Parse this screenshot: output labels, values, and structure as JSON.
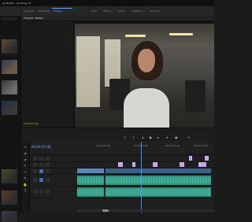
{
  "window": {
    "title": "Ae Master - p(change it)"
  },
  "workspaces": [
    {
      "label": "Learning",
      "active": false
    },
    {
      "label": "Assembly",
      "active": false
    },
    {
      "label": "Editing",
      "active": true
    },
    {
      "label": "Color",
      "active": false
    },
    {
      "label": "Effects",
      "active": false
    },
    {
      "label": "Audio",
      "active": false
    },
    {
      "label": "Graphics",
      "active": false
    },
    {
      "label": "Libraries",
      "active": false
    }
  ],
  "panels": {
    "source_tab": "Program: Master",
    "program_timecode": "00;00;07;08"
  },
  "timeline": {
    "current_time": "00;00;07;08",
    "ruler_labels": [
      "00;00;05;00",
      "00;00;10;00",
      "00;00;15;00",
      "00;00;20;00"
    ]
  },
  "colors": {
    "accent_blue": "#6aa8ff",
    "timecode_gold": "#d4a93a",
    "clip_video": "#5f86b8",
    "clip_audio": "#2f8f7b",
    "clip_pink": "#c9a6e5"
  }
}
